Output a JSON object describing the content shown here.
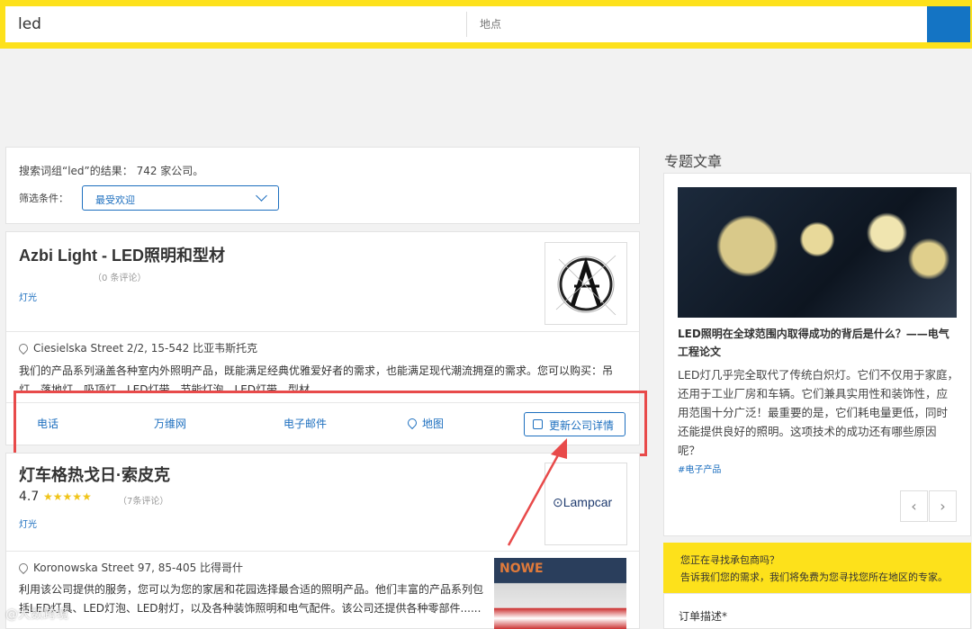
{
  "search": {
    "query": "led",
    "location_placeholder": "地点"
  },
  "filter": {
    "result_text": "搜索词组“led”的结果： 742 家公司。",
    "label": "筛选条件：",
    "selected": "最受欢迎"
  },
  "companies": [
    {
      "name": "Azbi Light - LED照明和型材",
      "reviews": "（0 条评论）",
      "category": "灯光",
      "address": "Ciesielska Street 2/2, 15-542 比亚韦斯托克",
      "description": "我们的产品系列涵盖各种室内外照明产品，既能满足经典优雅爱好者的需求，也能满足现代潮流拥趸的需求。您可以购买：吊灯、落地灯、吸顶灯、LED灯带、节能灯泡、LED灯带、型材"
    },
    {
      "name": "灯车格热戈日·索皮克",
      "rating": "4.7",
      "stars": "★★★★★",
      "reviews": "（7条评论）",
      "category": "灯光",
      "logo_text": "Lampcar",
      "address": "Koronowska Street 97, 85-405 比得哥什",
      "description": "利用该公司提供的服务，您可以为您的家居和花园选择最合适的照明产品。他们丰富的产品系列包括LED灯具、LED灯泡、LED射灯，以及各种装饰照明和电气配件。该公司还提供各种零部件......",
      "thumb_text": "NOWE"
    }
  ],
  "actions": {
    "phone": "电话",
    "web": "万维网",
    "email": "电子邮件",
    "map": "地图",
    "update": "更新公司详情"
  },
  "sidebar": {
    "title": "专题文章",
    "article_title": "LED照明在全球范围内取得成功的背后是什么？——电气工程论文",
    "article_text": "LED灯几乎完全取代了传统白炽灯。它们不仅用于家庭，还用于工业厂房和车辆。它们兼具实用性和装饰性，应用范围十分广泛！最重要的是，它们耗电量更低，同时还能提供良好的照明。这项技术的成功还有哪些原因呢？",
    "article_tag": "#电子产品",
    "prev": "‹",
    "next": "›",
    "promo_line1": "您正在寻找承包商吗？",
    "promo_line2": "告诉我们您的需求，我们将免费为您寻找您所在地区的专家。",
    "order_label": "订单描述*"
  },
  "watermark": "@大数跨境",
  "colors": {
    "accent_yellow": "#fde11b",
    "brand_blue": "#1474c4",
    "highlight_red": "#e84a4a"
  }
}
